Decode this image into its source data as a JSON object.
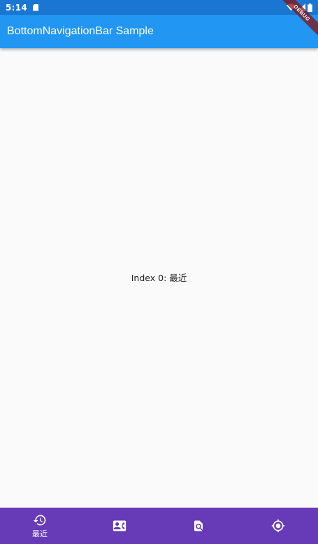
{
  "status_bar": {
    "time": "5:14",
    "icons": [
      "sd-card-icon",
      "wifi-icon",
      "signal-icon",
      "battery-icon"
    ]
  },
  "app_bar": {
    "title": "BottomNavigationBar Sample"
  },
  "debug_banner": {
    "label": "DEBUG"
  },
  "body": {
    "text": "Index 0: 最近"
  },
  "bottom_nav": {
    "background": "#673ab7",
    "selected_index": 0,
    "items": [
      {
        "icon": "history-icon",
        "label": "最近"
      },
      {
        "icon": "contact-card-icon",
        "label": ""
      },
      {
        "icon": "find-in-page-icon",
        "label": ""
      },
      {
        "icon": "my-location-icon",
        "label": ""
      }
    ]
  },
  "colors": {
    "status_bar": "#1976d2",
    "app_bar": "#2196f3",
    "bottom_nav": "#673ab7",
    "background": "#fafafa"
  }
}
